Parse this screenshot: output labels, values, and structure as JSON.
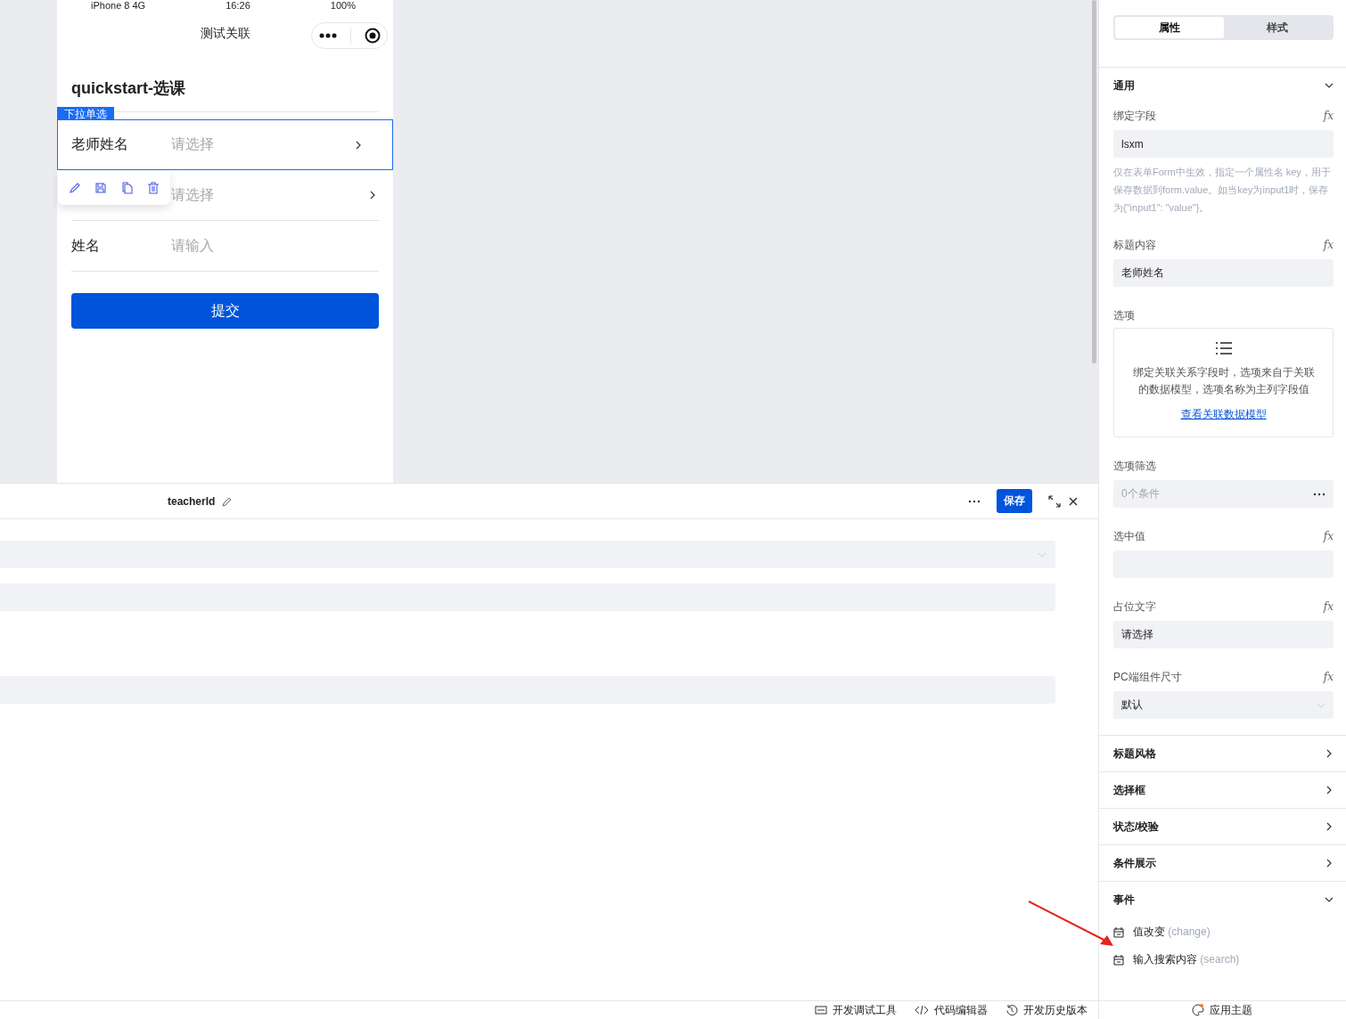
{
  "phone": {
    "status": {
      "carrier": "iPhone 8  4G",
      "time": "16:26",
      "battery": "100%"
    },
    "title": "测试关联",
    "form_title": "quickstart-选课",
    "selected_tag": "下拉单选",
    "fields": [
      {
        "kind": "select",
        "label": "老师姓名",
        "placeholder": "请选择",
        "selected": true
      },
      {
        "kind": "select",
        "placeholder": "请选择",
        "selected": false
      },
      {
        "kind": "input",
        "label": "姓名",
        "placeholder": "请输入",
        "selected": false
      }
    ],
    "submit": "提交"
  },
  "editor": {
    "title": "teacherId",
    "save": "保存",
    "rows": [
      {
        "kind": "select"
      },
      {
        "kind": "input"
      },
      {
        "kind": "gap"
      },
      {
        "kind": "input"
      }
    ]
  },
  "panel": {
    "tabs": [
      {
        "label": "属性",
        "selected": true
      },
      {
        "label": "样式",
        "selected": false
      }
    ],
    "general": {
      "title": "通用",
      "expanded": true,
      "props": [
        {
          "kind": "input",
          "label": "绑定字段",
          "formula": "fx",
          "value": "lsxm",
          "help": "仅在表单Form中生效，指定一个属性名 key，用于保存数据到form.value。如当key为input1时，保存为{\"input1\": \"value\"}。"
        },
        {
          "kind": "input",
          "label": "标题内容",
          "formula": "fx",
          "value": "老师姓名"
        },
        {
          "kind": "options",
          "label": "选项",
          "text": "绑定关联关系字段时，选项来自于关联的数据模型，选项名称为主列字段值",
          "link": "查看关联数据模型"
        },
        {
          "kind": "filter",
          "label": "选项筛选",
          "placeholder": "0个条件"
        },
        {
          "kind": "input",
          "label": "选中值",
          "formula": "fx"
        },
        {
          "kind": "input",
          "label": "占位文字",
          "formula": "fx",
          "value": "请选择"
        },
        {
          "kind": "select",
          "label": "PC端组件尺寸",
          "formula": "fx",
          "value": "默认"
        }
      ]
    },
    "sections": [
      {
        "title": "标题风格",
        "expanded": false
      },
      {
        "title": "选择框",
        "expanded": false
      },
      {
        "title": "状态/校验",
        "expanded": false
      },
      {
        "title": "条件展示",
        "expanded": false
      }
    ],
    "events": {
      "title": "事件",
      "expanded": true,
      "items": [
        {
          "name": "值改变",
          "event": "(change)"
        },
        {
          "name": "输入搜索内容",
          "event": "(search)"
        }
      ]
    }
  },
  "footer": {
    "tools": [
      {
        "kind": "debug",
        "label": "开发调试工具"
      },
      {
        "kind": "code",
        "label": "代码编辑器"
      },
      {
        "kind": "history",
        "label": "开发历史版本"
      }
    ],
    "theme": "应用主题"
  }
}
